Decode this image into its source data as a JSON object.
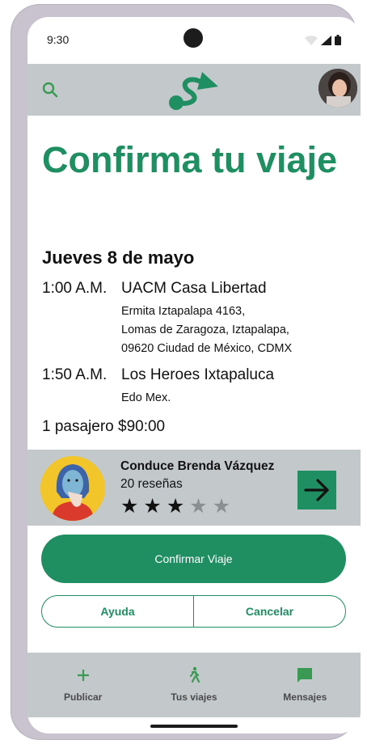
{
  "status_bar": {
    "time": "9:30"
  },
  "app": {
    "accent": "#1f8f62",
    "bar_color": "#c3c9cb"
  },
  "page": {
    "title": "Confirma tu viaje",
    "date": "Jueves 8 de mayo",
    "stops": [
      {
        "time": "1:00 A.M.",
        "place": "UACM Casa Libertad",
        "address_lines": [
          "Ermita Iztapalapa 4163,",
          "Lomas de Zaragoza, Iztapalapa,",
          "09620 Ciudad de México, CDMX"
        ]
      },
      {
        "time": "1:50 A.M.",
        "place": "Los Heroes Ixtapaluca",
        "address_lines": [
          "Edo Mex."
        ]
      }
    ],
    "price_line": "1 pasajero $90:00"
  },
  "driver": {
    "name_line": "Conduce Brenda Vázquez",
    "reviews": "20 reseñas",
    "rating": 3,
    "rating_max": 5,
    "stars_display": [
      "★",
      "★",
      "★",
      "★",
      "★"
    ]
  },
  "actions": {
    "confirm_label": "Confirmar Viaje",
    "help_label": "Ayuda",
    "cancel_label": "Cancelar"
  },
  "bottom_nav": {
    "items": [
      {
        "label": "Publicar",
        "icon": "plus-icon"
      },
      {
        "label": "Tus viajes",
        "icon": "walking-person-icon"
      },
      {
        "label": "Mensajes",
        "icon": "chat-icon"
      }
    ]
  }
}
